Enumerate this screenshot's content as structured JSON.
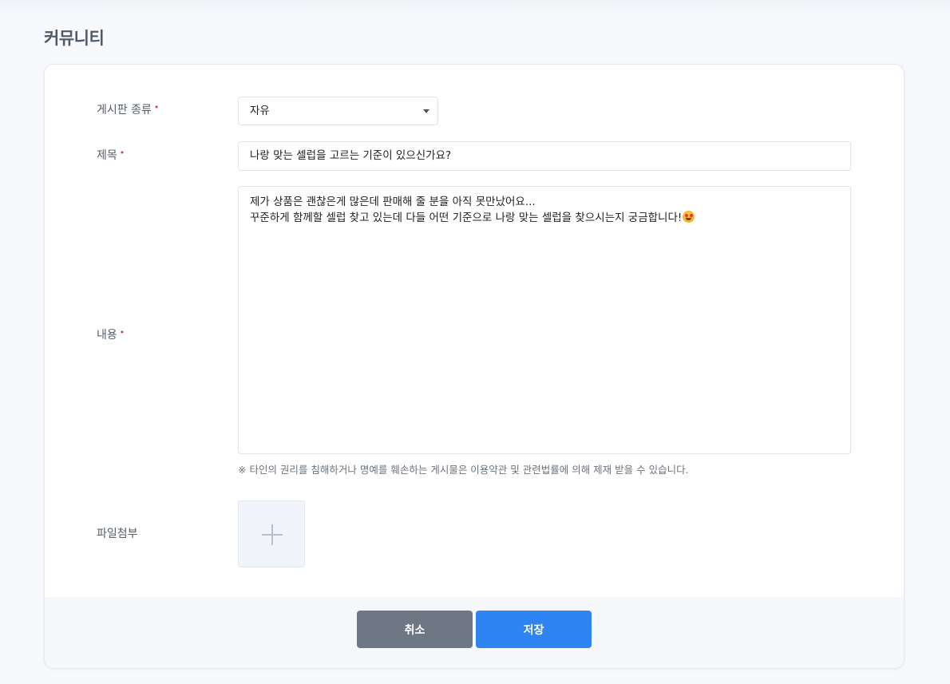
{
  "page": {
    "title": "커뮤니티"
  },
  "form": {
    "board_type": {
      "label": "게시판 종류",
      "required_mark": "•",
      "selected": "자유"
    },
    "title": {
      "label": "제목",
      "required_mark": "•",
      "value": "나랑 맞는 셀럽을 고르는 기준이 있으신가요?"
    },
    "content": {
      "label": "내용",
      "required_mark": "•",
      "lines": [
        "제가 상품은 괜찮은게 많은데 판매해 줄 분을 아직 못만났어요...",
        "꾸준하게 함께할 셀럽 찾고 있는데 다들 어떤 기준으로 나랑 맞는 셀럽을 찾으시는지 궁금합니다!"
      ],
      "emoji": "star-struck-emoji",
      "notice": "※ 타인의 권리를 침해하거나 명예를 훼손하는 게시물은 이용약관 및 관련법률에 의해 제재 받을 수 있습니다."
    },
    "attachment": {
      "label": "파일첨부",
      "add_icon": "plus-icon"
    }
  },
  "actions": {
    "cancel_label": "취소",
    "save_label": "저장"
  },
  "colors": {
    "required": "#e5393b",
    "save_button": "#2d84f2",
    "cancel_button": "#6e7784"
  }
}
